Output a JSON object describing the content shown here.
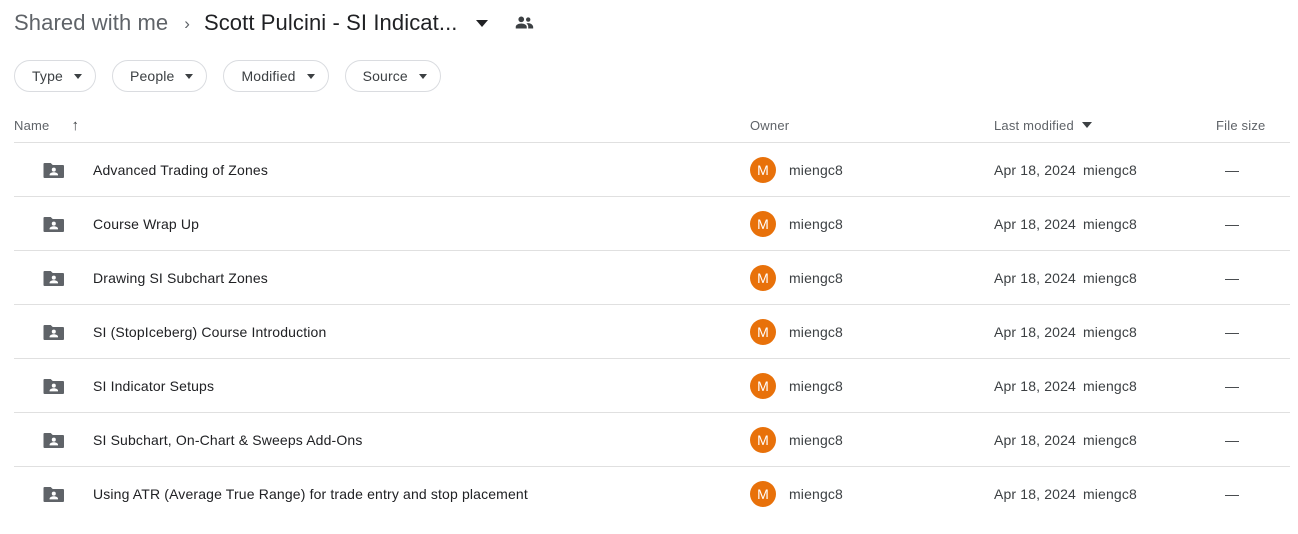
{
  "breadcrumb": {
    "parent": "Shared with me",
    "separator": "›",
    "current": "Scott Pulcini - SI Indicat...",
    "caret_icon": "chevron-down-icon",
    "share_icon": "people-shared-icon"
  },
  "filters": [
    {
      "label": "Type"
    },
    {
      "label": "People"
    },
    {
      "label": "Modified"
    },
    {
      "label": "Source"
    }
  ],
  "columns": {
    "name": "Name",
    "name_sort_icon": "arrow-up-icon",
    "owner": "Owner",
    "modified": "Last modified",
    "modified_sort_icon": "caret-down-icon",
    "size": "File size"
  },
  "colors": {
    "avatar_background": "#e8710a",
    "folder_icon": "#5f6368",
    "divider": "#e0e0e0",
    "chip_border": "#dadce0",
    "text_primary": "#202124",
    "text_secondary": "#5f6368"
  },
  "files": [
    {
      "icon": "shared-folder-icon",
      "name": "Advanced Trading of Zones",
      "owner_initial": "M",
      "owner": "miengc8",
      "modified_date": "Apr 18, 2024",
      "modified_by": "miengc8",
      "size": "—"
    },
    {
      "icon": "shared-folder-icon",
      "name": "Course Wrap Up",
      "owner_initial": "M",
      "owner": "miengc8",
      "modified_date": "Apr 18, 2024",
      "modified_by": "miengc8",
      "size": "—"
    },
    {
      "icon": "shared-folder-icon",
      "name": "Drawing SI Subchart Zones",
      "owner_initial": "M",
      "owner": "miengc8",
      "modified_date": "Apr 18, 2024",
      "modified_by": "miengc8",
      "size": "—"
    },
    {
      "icon": "shared-folder-icon",
      "name": "SI (StopIceberg) Course Introduction",
      "owner_initial": "M",
      "owner": "miengc8",
      "modified_date": "Apr 18, 2024",
      "modified_by": "miengc8",
      "size": "—"
    },
    {
      "icon": "shared-folder-icon",
      "name": "SI Indicator Setups",
      "owner_initial": "M",
      "owner": "miengc8",
      "modified_date": "Apr 18, 2024",
      "modified_by": "miengc8",
      "size": "—"
    },
    {
      "icon": "shared-folder-icon",
      "name": "SI Subchart, On-Chart & Sweeps Add-Ons",
      "owner_initial": "M",
      "owner": "miengc8",
      "modified_date": "Apr 18, 2024",
      "modified_by": "miengc8",
      "size": "—"
    },
    {
      "icon": "shared-folder-icon",
      "name": "Using ATR (Average True Range) for trade entry and stop placement",
      "owner_initial": "M",
      "owner": "miengc8",
      "modified_date": "Apr 18, 2024",
      "modified_by": "miengc8",
      "size": "—"
    }
  ]
}
